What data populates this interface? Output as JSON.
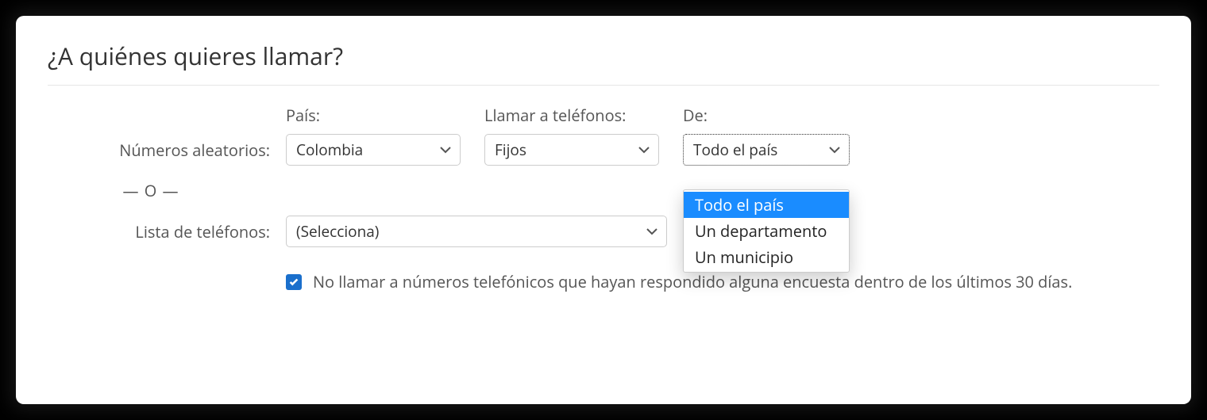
{
  "title": "¿A quiénes quieres llamar?",
  "row_labels": {
    "random_numbers": "Números aleatorios:",
    "or": "— O —",
    "phone_list": "Lista de teléfonos:"
  },
  "columns": {
    "pais": {
      "label": "País:",
      "value": "Colombia"
    },
    "llamar": {
      "label": "Llamar a teléfonos:",
      "value": "Fijos"
    },
    "de": {
      "label": "De:",
      "value": "Todo el país",
      "options": [
        "Todo el país",
        "Un departamento",
        "Un municipio"
      ]
    }
  },
  "phone_list_select": "(Selecciona)",
  "checkbox": {
    "checked": true,
    "label": "No llamar a números telefónicos que hayan respondido alguna encuesta dentro de los últimos 30 días."
  }
}
